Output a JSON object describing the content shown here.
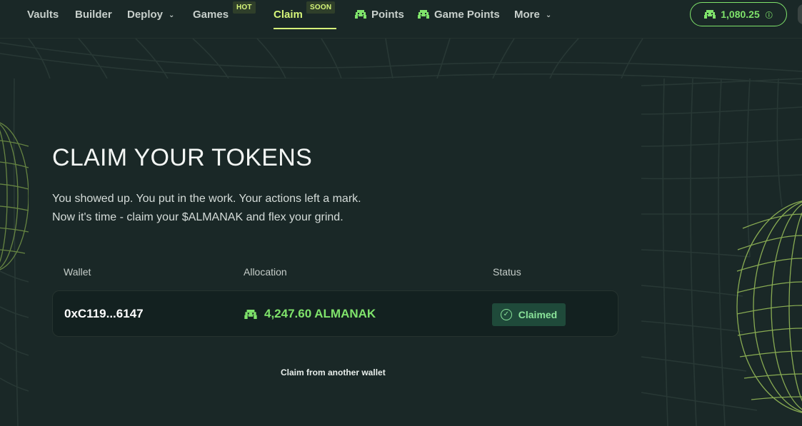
{
  "nav": {
    "vaults": "Vaults",
    "builder": "Builder",
    "deploy": "Deploy",
    "games": "Games",
    "games_badge": "HOT",
    "claim": "Claim",
    "claim_badge": "SOON",
    "points": "Points",
    "game_points": "Game Points",
    "more": "More"
  },
  "points_pill": {
    "value": "1,080.25"
  },
  "hero": {
    "title": "CLAIM YOUR TOKENS",
    "line1": "You showed up. You put in the work. Your actions left a mark.",
    "line2": "Now it's time - claim your $ALMANAK and flex your grind."
  },
  "table": {
    "headers": [
      "Wallet",
      "Allocation",
      "Status"
    ],
    "rows": [
      {
        "wallet": "0xC119...6147",
        "allocation": "4,247.60 ALMANAK",
        "status": "Claimed"
      }
    ]
  },
  "footer_link": "Claim from another wallet",
  "colors": {
    "background": "#1a2827",
    "accent_lime": "#d6f57a",
    "accent_green": "#7fe36b",
    "status_bg": "#1f4a3a"
  },
  "icons": {
    "points": "invader-icon",
    "dropdown": "chevron-down-icon",
    "info": "info-icon",
    "status": "check-circle-icon"
  }
}
